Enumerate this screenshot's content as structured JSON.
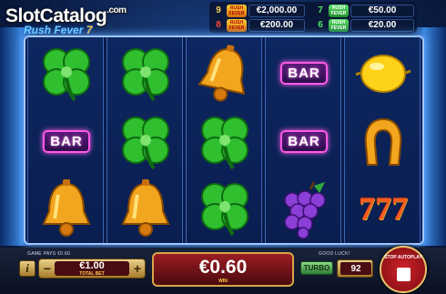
{
  "logo": {
    "watermark": "SlotCatalog",
    "watermark_suffix": ".com",
    "game_word_1": "Rush",
    "game_word_2": "Fever",
    "game_word_3": "7"
  },
  "jackpots": [
    {
      "count": "9",
      "label": "RUSH FEVER",
      "value": "€2,000.00",
      "badge": "gold"
    },
    {
      "count": "7",
      "label": "RUSH FEVER",
      "value": "€50.00",
      "badge": "green"
    },
    {
      "count": "8",
      "label": "RUSH FEVER",
      "value": "€200.00",
      "badge": "gold"
    },
    {
      "count": "6",
      "label": "RUSH FEVER",
      "value": "€20.00",
      "badge": "green"
    }
  ],
  "reels": [
    [
      "clover-icon",
      "bar-icon",
      "bell-icon"
    ],
    [
      "clover-icon",
      "clover-icon",
      "bell-icon"
    ],
    [
      "bell-icon",
      "clover-icon",
      "clover-icon"
    ],
    [
      "bar-icon",
      "bar-icon",
      "grapes-icon"
    ],
    [
      "lemon-icon",
      "horseshoe-icon",
      "seven-icon"
    ]
  ],
  "symbol_text": {
    "bar": "BAR",
    "seven": "777"
  },
  "status": {
    "game_pays": "GAME PAYS €0.60",
    "good_luck": "GOOD LUCK!"
  },
  "controls": {
    "info_label": "i",
    "bet_minus": "−",
    "bet_plus": "+",
    "bet_value": "€1.00",
    "bet_caption": "TOTAL BET",
    "win_value": "€0.60",
    "win_caption": "WIN",
    "turbo_label": "TURBO",
    "autoplay_count": "92",
    "stop_label": "STOP AUTOPLAY"
  },
  "colors": {
    "accent_gold": "#d9a547",
    "win_panel": "#9b1d22",
    "bar_glow": "#ff5ae6"
  }
}
